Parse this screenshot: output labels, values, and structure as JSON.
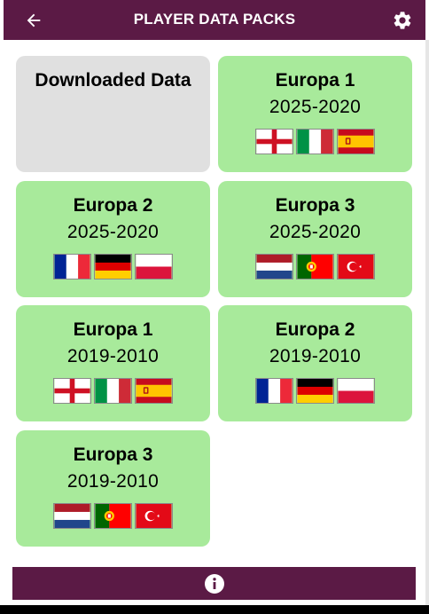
{
  "app_bar": {
    "title": "PLAYER DATA PACKS",
    "back_icon": "arrow-left-icon",
    "settings_icon": "gear-icon",
    "color": "#5b1a45"
  },
  "downloaded": {
    "label": "Downloaded Data",
    "color": "#e0e0e0"
  },
  "card_color": "#a8ea9b",
  "packs": [
    {
      "name": "Europa 1",
      "years": "2025-2020",
      "flags": [
        "england",
        "italy",
        "spain"
      ]
    },
    {
      "name": "Europa 2",
      "years": "2025-2020",
      "flags": [
        "france",
        "germany",
        "poland"
      ]
    },
    {
      "name": "Europa 3",
      "years": "2025-2020",
      "flags": [
        "netherlands",
        "portugal",
        "turkey"
      ]
    },
    {
      "name": "Europa 1",
      "years": "2019-2010",
      "flags": [
        "england",
        "italy",
        "spain"
      ]
    },
    {
      "name": "Europa 2",
      "years": "2019-2010",
      "flags": [
        "france",
        "germany",
        "poland"
      ]
    },
    {
      "name": "Europa 3",
      "years": "2019-2010",
      "flags": [
        "netherlands",
        "portugal",
        "turkey"
      ]
    }
  ],
  "bottom_bar": {
    "icon": "info-icon"
  }
}
